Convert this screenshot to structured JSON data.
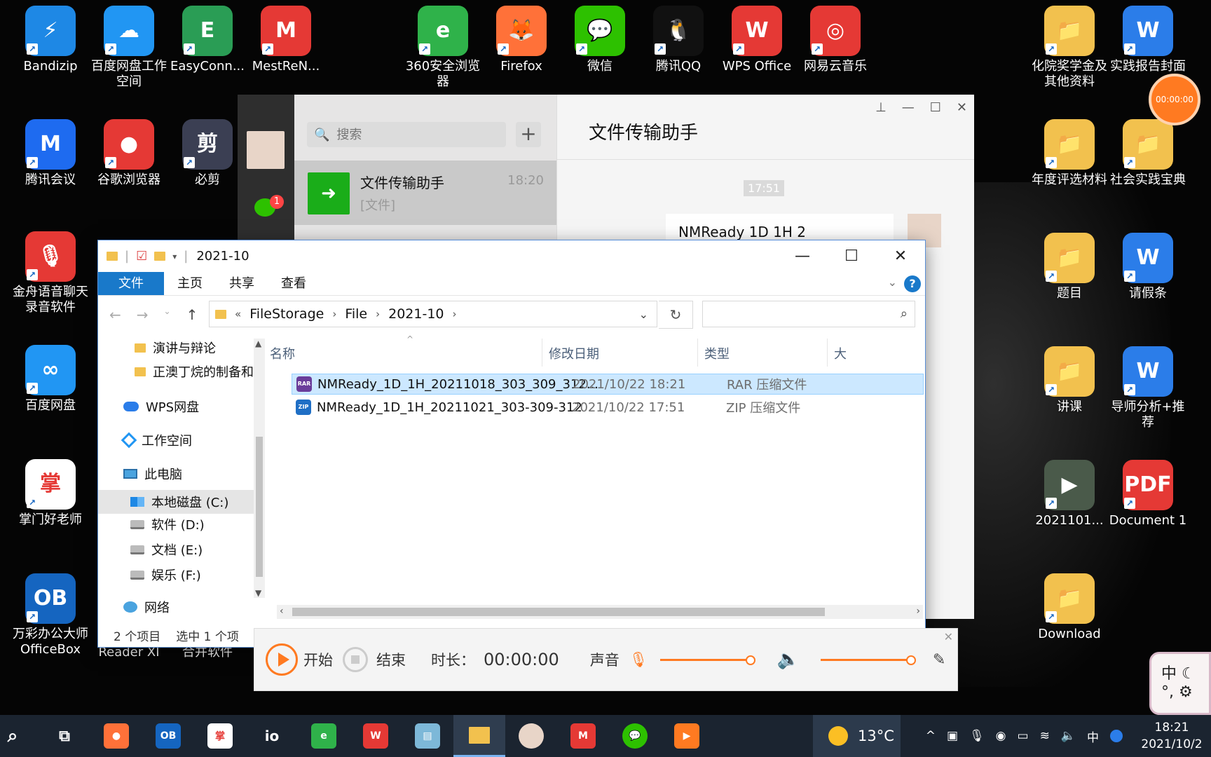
{
  "desktop": {
    "icons_left": [
      {
        "label": "Bandizip",
        "glyph": "⚡",
        "color": "#1e88e5"
      },
      {
        "label": "百度网盘工作空间",
        "glyph": "☁",
        "color": "#2196f3"
      },
      {
        "label": "EasyConn...",
        "glyph": "E",
        "color": "#2a9d55"
      },
      {
        "label": "MestReN...",
        "glyph": "M",
        "color": "#e53935"
      },
      {
        "label": "腾讯会议",
        "glyph": "M",
        "color": "#1e6bf0"
      },
      {
        "label": "谷歌浏览器",
        "glyph": "●",
        "color": "#e53935"
      },
      {
        "label": "必剪",
        "glyph": "剪",
        "color": "#3b3f53"
      },
      {
        "label": "金舟语音聊天录音软件",
        "glyph": "🎙",
        "color": "#e53935"
      },
      {
        "label": "百度网盘",
        "glyph": "∞",
        "color": "#2196f3"
      },
      {
        "label": "掌门好老师",
        "glyph": "掌",
        "color": "#ffffff"
      },
      {
        "label": "万彩办公大师 OfficeBox",
        "glyph": "OB",
        "color": "#1565c0"
      }
    ],
    "icons_top": [
      {
        "label": "360安全浏览器",
        "glyph": "e",
        "color": "#2fb24a"
      },
      {
        "label": "Firefox",
        "glyph": "🦊",
        "color": "#ff7139"
      },
      {
        "label": "微信",
        "glyph": "💬",
        "color": "#2dc100"
      },
      {
        "label": "腾讯QQ",
        "glyph": "🐧",
        "color": "#111111"
      },
      {
        "label": "WPS Office",
        "glyph": "W",
        "color": "#e53935"
      },
      {
        "label": "网易云音乐",
        "glyph": "◎",
        "color": "#e53935"
      }
    ],
    "icons_right": [
      {
        "label": "化院奖学金及其他资料",
        "glyph": "📁",
        "color": "#f2c14e"
      },
      {
        "label": "实践报告封面",
        "glyph": "W",
        "color": "#2b7de9"
      },
      {
        "label": "年度评选材料",
        "glyph": "📁",
        "color": "#f2c14e"
      },
      {
        "label": "社会实践宝典",
        "glyph": "📁",
        "color": "#f2c14e"
      },
      {
        "label": "题目",
        "glyph": "📁",
        "color": "#f2c14e"
      },
      {
        "label": "请假条",
        "glyph": "W",
        "color": "#2b7de9"
      },
      {
        "label": "讲课",
        "glyph": "📁",
        "color": "#f2c14e"
      },
      {
        "label": "导师分析+推荐",
        "glyph": "W",
        "color": "#2b7de9"
      },
      {
        "label": "2021101...",
        "glyph": "▶",
        "color": "#4a5a4a"
      },
      {
        "label": "Document 1",
        "glyph": "PDF",
        "color": "#e53935"
      },
      {
        "label": "Download",
        "glyph": "📁",
        "color": "#f2c14e"
      }
    ],
    "partial_labels": {
      "reader": "Reader XI",
      "merge": "合并软件"
    },
    "record_timer": "00:00:00"
  },
  "wechat": {
    "search_placeholder": "搜索",
    "badge": "1",
    "chat_name": "文件传输助手",
    "chat_time": "18:20",
    "chat_preview": "[文件]",
    "title": "文件传输助手",
    "timestamp": "17:51",
    "file_msg": "NMReady 1D 1H 2"
  },
  "explorer": {
    "title": "2021-10",
    "ribbon": [
      "文件",
      "主页",
      "共享",
      "查看"
    ],
    "breadcrumb": [
      "FileStorage",
      "File",
      "2021-10"
    ],
    "columns": {
      "name": "名称",
      "date": "修改日期",
      "type": "类型",
      "size": "大"
    },
    "nav": [
      {
        "label": "演讲与辩论",
        "icon": "folder"
      },
      {
        "label": "正澳丁烷的制备和",
        "icon": "folder"
      },
      {
        "label": "WPS网盘",
        "icon": "cloud"
      },
      {
        "label": "工作空间",
        "icon": "workspace"
      },
      {
        "label": "此电脑",
        "icon": "pc"
      },
      {
        "label": "本地磁盘 (C:)",
        "icon": "windows-drive"
      },
      {
        "label": "软件 (D:)",
        "icon": "drive"
      },
      {
        "label": "文档 (E:)",
        "icon": "drive"
      },
      {
        "label": "娱乐 (F:)",
        "icon": "drive"
      },
      {
        "label": "网络",
        "icon": "network"
      }
    ],
    "files": [
      {
        "name": "NMReady_1D_1H_20211018_303_309_312...",
        "date": "2021/10/22 18:21",
        "type": "RAR 压缩文件",
        "icon": "RAR"
      },
      {
        "name": "NMReady_1D_1H_20211021_303-309-312",
        "date": "2021/10/22 17:51",
        "type": "ZIP 压缩文件",
        "icon": "ZIP"
      }
    ],
    "status_count": "2 个项目",
    "status_selected": "选中 1 个项"
  },
  "recorder": {
    "start": "开始",
    "stop": "结束",
    "duration_label": "时长：",
    "duration": "00:00:00",
    "sound": "声音",
    "mic_level": 1.0,
    "speaker_level": 1.0
  },
  "taskbar": {
    "weather": "13°C",
    "time": "18:21",
    "date": "2021/10/2",
    "ime": "中"
  }
}
